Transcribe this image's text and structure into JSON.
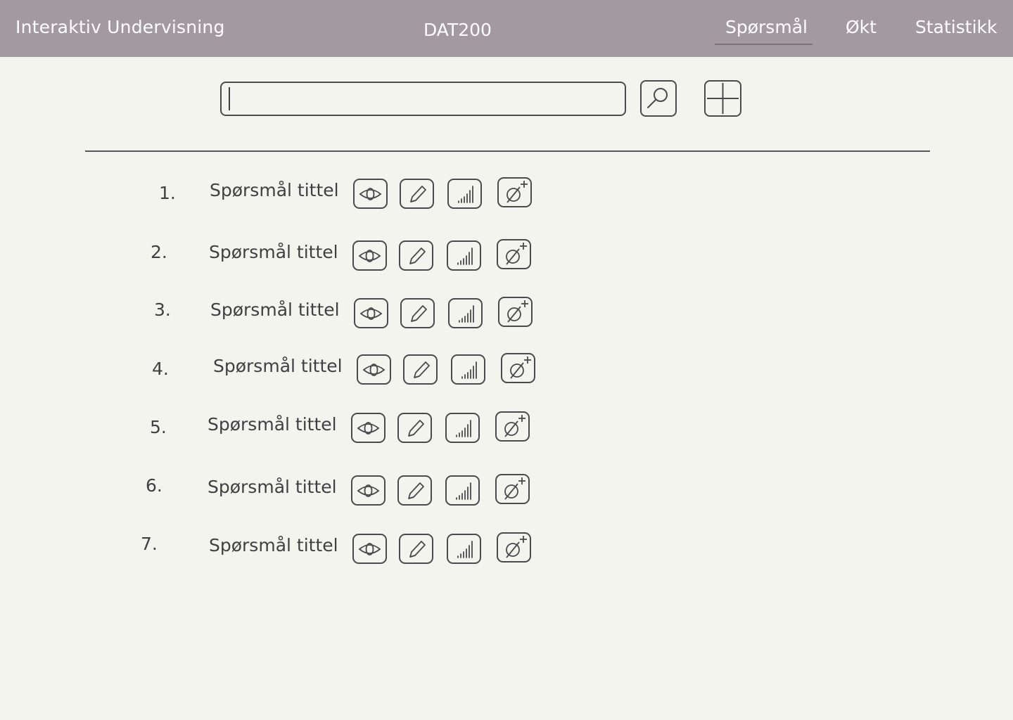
{
  "header": {
    "app_title": "Interaktiv Undervisning",
    "course_code": "DAT200",
    "nav": [
      {
        "label": "Spørsmål",
        "active": true
      },
      {
        "label": "Økt",
        "active": false
      },
      {
        "label": "Statistikk",
        "active": false
      }
    ]
  },
  "toolbar": {
    "search_value": "",
    "search_icon": "magnifier-icon",
    "add_icon": "plus-icon"
  },
  "questions": [
    {
      "number": "1.",
      "title": "Spørsmål tittel"
    },
    {
      "number": "2.",
      "title": "Spørsmål tittel"
    },
    {
      "number": "3.",
      "title": "Spørsmål tittel"
    },
    {
      "number": "4.",
      "title": "Spørsmål tittel"
    },
    {
      "number": "5.",
      "title": "Spørsmål tittel"
    },
    {
      "number": "6.",
      "title": "Spørsmål tittel"
    },
    {
      "number": "7.",
      "title": "Spørsmål tittel"
    }
  ],
  "row_actions": [
    {
      "icon": "eye-icon",
      "action": "view"
    },
    {
      "icon": "pencil-icon",
      "action": "edit"
    },
    {
      "icon": "signal-bars-icon",
      "action": "statistics"
    },
    {
      "icon": "empty-set-plus-icon",
      "action": "add-to-session"
    }
  ],
  "colors": {
    "header_bg": "#a39aa1",
    "page_bg": "#f4f4ef",
    "text": "#3f3f44",
    "active_underline": "#7f6f78"
  }
}
